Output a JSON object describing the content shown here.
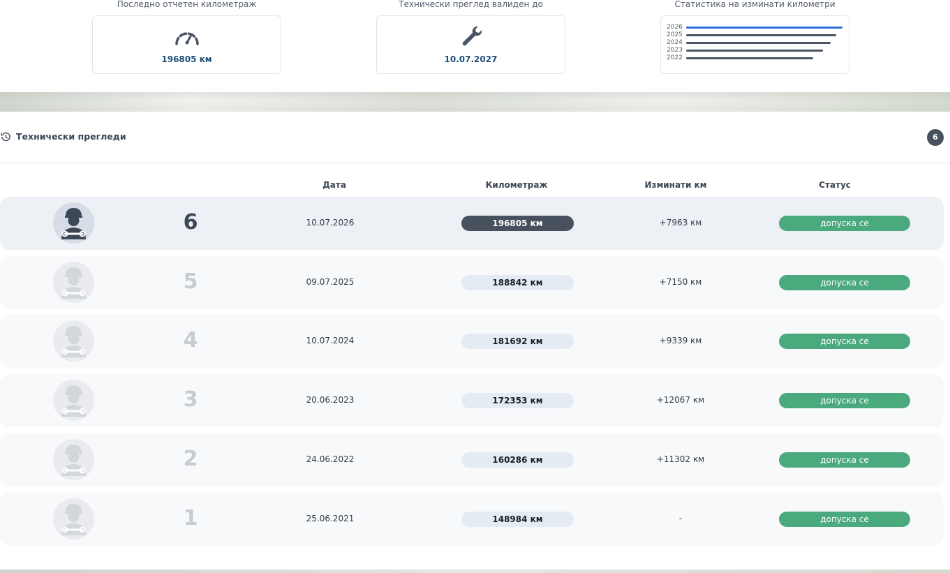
{
  "summary": {
    "mileage": {
      "title": "Последно отчетен километраж",
      "value": "196805 км",
      "icon": "speedometer-icon"
    },
    "inspection": {
      "title": "Технически преглед валиден до",
      "value": "10.07.2027",
      "icon": "wrench-icon"
    },
    "stats": {
      "title": "Статистика на изминати километри",
      "bars": [
        {
          "year": "2026",
          "value": 196805
        },
        {
          "year": "2025",
          "value": 188842
        },
        {
          "year": "2024",
          "value": 181692
        },
        {
          "year": "2023",
          "value": 172353
        },
        {
          "year": "2022",
          "value": 160286
        }
      ],
      "current_color": "#2e6ed6",
      "bar_color": "#4a5563"
    }
  },
  "section": {
    "title": "Технически прегледи",
    "count": "6",
    "icon": "history-icon"
  },
  "table": {
    "headers": {
      "date": "Дата",
      "mileage": "Километраж",
      "traveled": "Изминати км",
      "status": "Статус"
    },
    "rows": [
      {
        "num": "6",
        "date": "10.07.2026",
        "km": "196805 км",
        "diff": "+7963 км",
        "status": "допуска се",
        "current": true
      },
      {
        "num": "5",
        "date": "09.07.2025",
        "km": "188842 км",
        "diff": "+7150 км",
        "status": "допуска се"
      },
      {
        "num": "4",
        "date": "10.07.2024",
        "km": "181692 км",
        "diff": "+9339 км",
        "status": "допуска се"
      },
      {
        "num": "3",
        "date": "20.06.2023",
        "km": "172353 км",
        "diff": "+12067 км",
        "status": "допуска се"
      },
      {
        "num": "2",
        "date": "24.06.2022",
        "km": "160286 км",
        "diff": "+11302 км",
        "status": "допуска се"
      },
      {
        "num": "1",
        "date": "25.06.2021",
        "km": "148984 км",
        "diff": "-",
        "status": "допуска се"
      }
    ]
  },
  "colors": {
    "status_ok": "#4aaa7d",
    "accent": "#1e4f7a",
    "dark_pill": "#48525f"
  }
}
